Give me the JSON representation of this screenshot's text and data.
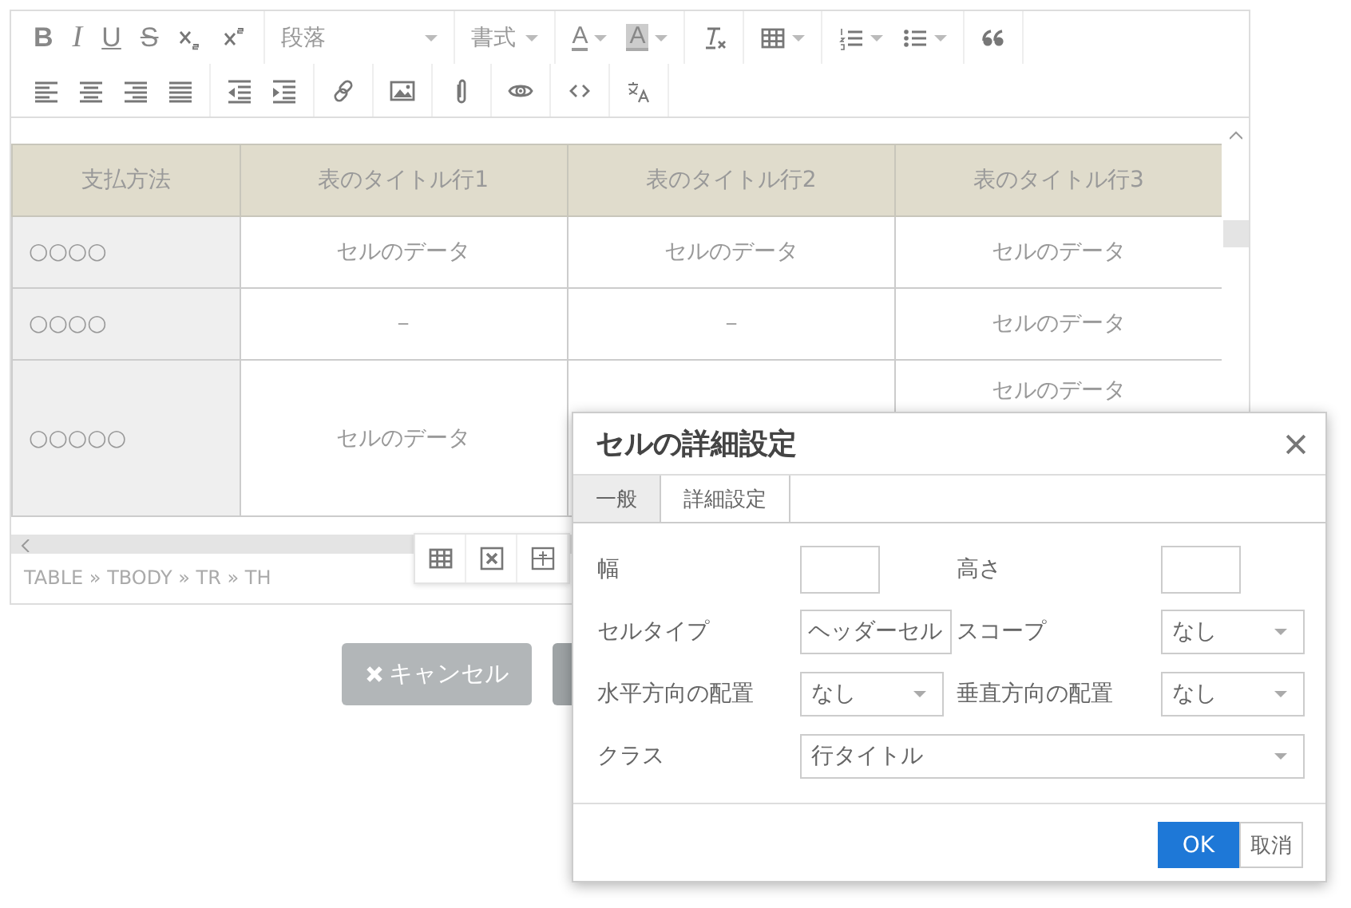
{
  "editor": {
    "toolbar_rows": [
      [
        {
          "items": [
            {
              "kind": "bold",
              "label": "B"
            },
            {
              "kind": "italic",
              "label": "I"
            },
            {
              "kind": "underline",
              "label": "U"
            },
            {
              "kind": "strike",
              "label": "S"
            },
            {
              "kind": "subscript"
            },
            {
              "kind": "superscript"
            }
          ]
        },
        {
          "items": [
            {
              "kind": "combo",
              "label": "段落"
            }
          ]
        },
        {
          "items": [
            {
              "kind": "combo",
              "label": "書式"
            }
          ]
        },
        {
          "items": [
            {
              "kind": "textcolor",
              "label": "A",
              "dropdown": true
            },
            {
              "kind": "bgcolor",
              "label": "A",
              "dropdown": true
            }
          ]
        },
        {
          "items": [
            {
              "kind": "clear"
            }
          ]
        },
        {
          "items": [
            {
              "kind": "table",
              "dropdown": true
            }
          ]
        },
        {
          "items": [
            {
              "kind": "ol",
              "dropdown": true
            },
            {
              "kind": "ul",
              "dropdown": true
            }
          ]
        },
        {
          "items": [
            {
              "kind": "quote"
            }
          ]
        }
      ],
      [
        {
          "items": [
            {
              "kind": "alignleft"
            },
            {
              "kind": "aligncenter"
            },
            {
              "kind": "alignright"
            },
            {
              "kind": "justify"
            }
          ]
        },
        {
          "items": [
            {
              "kind": "outdent"
            },
            {
              "kind": "indent"
            }
          ]
        },
        {
          "items": [
            {
              "kind": "link"
            }
          ]
        },
        {
          "items": [
            {
              "kind": "image"
            }
          ]
        },
        {
          "items": [
            {
              "kind": "attach"
            }
          ]
        },
        {
          "items": [
            {
              "kind": "preview"
            }
          ]
        },
        {
          "items": [
            {
              "kind": "code"
            }
          ]
        },
        {
          "items": [
            {
              "kind": "translate"
            }
          ]
        }
      ]
    ],
    "table": {
      "columns": [
        "支払方法",
        "表のタイトル行1",
        "表のタイトル行2",
        "表のタイトル行3"
      ],
      "rows": [
        {
          "cells": [
            "○○○○",
            "セルのデータ",
            "セルのデータ",
            "セルのデータ"
          ]
        },
        {
          "cells": [
            "○○○○",
            "－",
            "－",
            "セルのデータ"
          ]
        },
        {
          "cells": [
            "○○○○○",
            "セルのデータ",
            "",
            "セルのデータ"
          ]
        }
      ]
    },
    "status_path": "TABLE » TBODY » TR » TH"
  },
  "buttons": [
    {
      "kind": "cancel",
      "label": "キャンセル"
    },
    {
      "kind": "hidden"
    }
  ],
  "dialog": {
    "title": "セルの詳細設定",
    "tabs": [
      {
        "label": "一般",
        "selected": true
      },
      {
        "label": "詳細設定",
        "selected": false
      }
    ],
    "fields": [
      [
        {
          "label": "幅",
          "kind": "input"
        },
        {
          "label": "高さ",
          "kind": "input"
        }
      ],
      [
        {
          "label": "セルタイプ",
          "kind": "select",
          "value": "ヘッダーセル"
        },
        {
          "label": "スコープ",
          "kind": "select",
          "value": "なし"
        }
      ],
      [
        {
          "label": "水平方向の配置",
          "kind": "select",
          "value": "なし"
        },
        {
          "label": "垂直方向の配置",
          "kind": "select",
          "value": "なし"
        }
      ],
      [
        {
          "label": "クラス",
          "kind": "select",
          "value": "行タイトル"
        }
      ]
    ],
    "ok": "OK",
    "cancel": "取消"
  }
}
